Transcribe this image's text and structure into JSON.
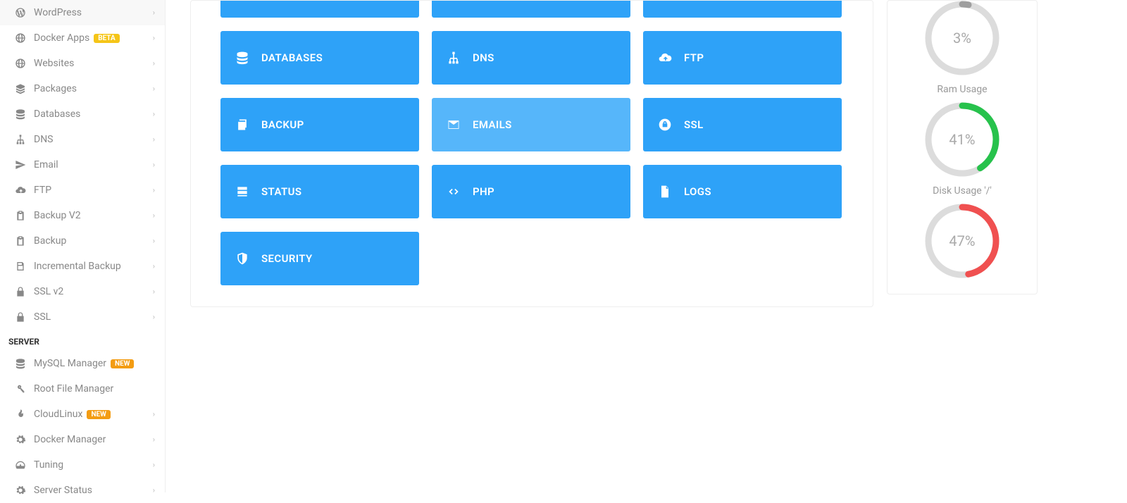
{
  "sidebar": {
    "items": [
      {
        "label": "WordPress",
        "icon": "wordpress",
        "chevron": true
      },
      {
        "label": "Docker Apps",
        "icon": "globe",
        "badge": "BETA",
        "badgeClass": "beta",
        "chevron": true
      },
      {
        "label": "Websites",
        "icon": "globe",
        "chevron": true
      },
      {
        "label": "Packages",
        "icon": "packages",
        "chevron": true
      },
      {
        "label": "Databases",
        "icon": "database",
        "chevron": true
      },
      {
        "label": "DNS",
        "icon": "sitemap",
        "chevron": true
      },
      {
        "label": "Email",
        "icon": "paperplane",
        "chevron": true
      },
      {
        "label": "FTP",
        "icon": "cloud",
        "chevron": true
      },
      {
        "label": "Backup V2",
        "icon": "clipboard",
        "chevron": true
      },
      {
        "label": "Backup",
        "icon": "clipboard",
        "chevron": true
      },
      {
        "label": "Incremental Backup",
        "icon": "save",
        "chevron": true
      },
      {
        "label": "SSL v2",
        "icon": "lock",
        "chevron": true
      },
      {
        "label": "SSL",
        "icon": "lock",
        "chevron": true
      }
    ],
    "header": "SERVER",
    "serverItems": [
      {
        "label": "MySQL Manager",
        "icon": "database",
        "badge": "NEW",
        "badgeClass": "new"
      },
      {
        "label": "Root File Manager",
        "icon": "key"
      },
      {
        "label": "CloudLinux",
        "icon": "fire",
        "badge": "NEW",
        "badgeClass": "new",
        "chevron": true
      },
      {
        "label": "Docker Manager",
        "icon": "cog",
        "chevron": true
      },
      {
        "label": "Tuning",
        "icon": "tach",
        "chevron": true
      },
      {
        "label": "Server Status",
        "icon": "cog",
        "chevron": true
      }
    ]
  },
  "cards": [
    {
      "label": "DATABASES",
      "icon": "database"
    },
    {
      "label": "DNS",
      "icon": "sitemap"
    },
    {
      "label": "FTP",
      "icon": "cloud"
    },
    {
      "label": "BACKUP",
      "icon": "copy"
    },
    {
      "label": "EMAILS",
      "icon": "envelope",
      "hover": true
    },
    {
      "label": "SSL",
      "icon": "lockcircle"
    },
    {
      "label": "STATUS",
      "icon": "server"
    },
    {
      "label": "PHP",
      "icon": "code"
    },
    {
      "label": "LOGS",
      "icon": "file"
    },
    {
      "label": "SECURITY",
      "icon": "shield"
    }
  ],
  "gauges": [
    {
      "label": "",
      "value": 3,
      "display": "3%",
      "color": "#9e9e9e",
      "showLabel": false
    },
    {
      "label": "Ram Usage",
      "value": 41,
      "display": "41%",
      "color": "#27c24c",
      "showLabel": true
    },
    {
      "label": "Disk Usage '/'",
      "value": 47,
      "display": "47%",
      "color": "#f05050",
      "showLabel": true
    }
  ]
}
